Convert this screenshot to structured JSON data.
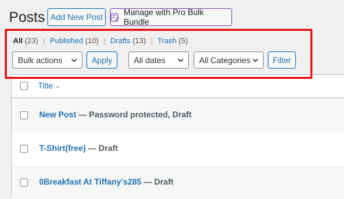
{
  "header": {
    "title": "Posts",
    "add_new_label": "Add New Post",
    "bundle_label": "Manage with Pro Bulk Bundle",
    "bundle_icon": "edit-list-icon"
  },
  "views": {
    "all": {
      "label": "All",
      "count": "(23)"
    },
    "published": {
      "label": "Published",
      "count": "(10)"
    },
    "drafts": {
      "label": "Drafts",
      "count": "(13)"
    },
    "trash": {
      "label": "Trash",
      "count": "(5)"
    },
    "separator": "|"
  },
  "filters": {
    "bulk_actions": "Bulk actions",
    "apply_label": "Apply",
    "dates": "All dates",
    "categories": "All Categories",
    "filter_label": "Filter"
  },
  "table": {
    "title_column": "Title",
    "rows": [
      {
        "title": "New Post",
        "state": " — Password protected, Draft"
      },
      {
        "title": "T-Shirt(free)",
        "state": " — Draft"
      },
      {
        "title": "0Breakfast At Tiffany's285",
        "state": " — Draft"
      }
    ]
  },
  "colors": {
    "link": "#2271b1",
    "highlight": "#e91616",
    "background": "#f0f0f1"
  }
}
